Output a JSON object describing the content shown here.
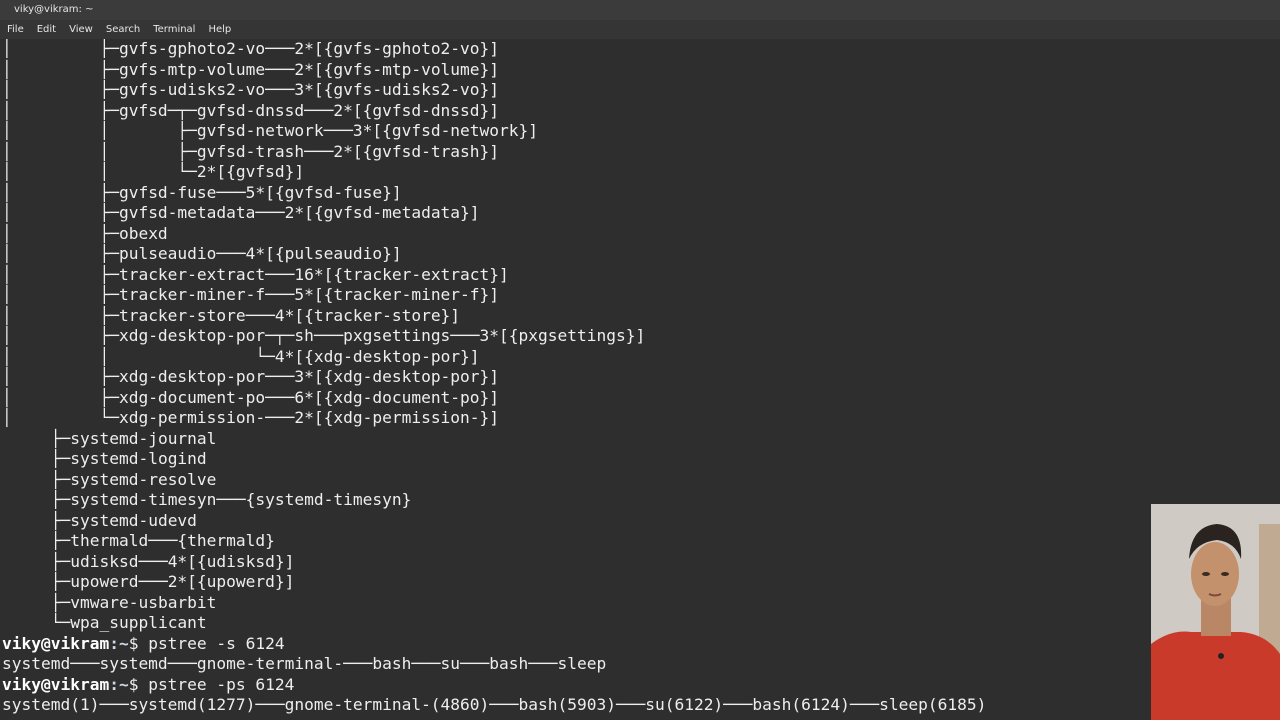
{
  "window": {
    "title": "viky@vikram: ~"
  },
  "menu": [
    "File",
    "Edit",
    "View",
    "Search",
    "Terminal",
    "Help"
  ],
  "terminal": {
    "lines": [
      {
        "tree": "│         ├─",
        "text": "gvfs-gphoto2-vo───2*[{gvfs-gphoto2-vo}]"
      },
      {
        "tree": "│         ├─",
        "text": "gvfs-mtp-volume───2*[{gvfs-mtp-volume}]"
      },
      {
        "tree": "│         ├─",
        "text": "gvfs-udisks2-vo───3*[{gvfs-udisks2-vo}]"
      },
      {
        "tree": "│         ├─",
        "text": "gvfsd─┬─gvfsd-dnssd───2*[{gvfsd-dnssd}]"
      },
      {
        "tree": "│         │       ├─",
        "text": "gvfsd-network───3*[{gvfsd-network}]"
      },
      {
        "tree": "│         │       ├─",
        "text": "gvfsd-trash───2*[{gvfsd-trash}]"
      },
      {
        "tree": "│         │       └─",
        "text": "2*[{gvfsd}]"
      },
      {
        "tree": "│         ├─",
        "text": "gvfsd-fuse───5*[{gvfsd-fuse}]"
      },
      {
        "tree": "│         ├─",
        "text": "gvfsd-metadata───2*[{gvfsd-metadata}]"
      },
      {
        "tree": "│         ├─",
        "text": "obexd"
      },
      {
        "tree": "│         ├─",
        "text": "pulseaudio───4*[{pulseaudio}]"
      },
      {
        "tree": "│         ├─",
        "text": "tracker-extract───16*[{tracker-extract}]"
      },
      {
        "tree": "│         ├─",
        "text": "tracker-miner-f───5*[{tracker-miner-f}]"
      },
      {
        "tree": "│         ├─",
        "text": "tracker-store───4*[{tracker-store}]"
      },
      {
        "tree": "│         ├─",
        "text": "xdg-desktop-por─┬─sh───pxgsettings───3*[{pxgsettings}]"
      },
      {
        "tree": "│         │               └─",
        "text": "4*[{xdg-desktop-por}]"
      },
      {
        "tree": "│         ├─",
        "text": "xdg-desktop-por───3*[{xdg-desktop-por}]"
      },
      {
        "tree": "│         ├─",
        "text": "xdg-document-po───6*[{xdg-document-po}]"
      },
      {
        "tree": "│         └─",
        "text": "xdg-permission-───2*[{xdg-permission-}]"
      },
      {
        "tree": "     ├─",
        "text": "systemd-journal"
      },
      {
        "tree": "     ├─",
        "text": "systemd-logind"
      },
      {
        "tree": "     ├─",
        "text": "systemd-resolve"
      },
      {
        "tree": "     ├─",
        "text": "systemd-timesyn───{systemd-timesyn}"
      },
      {
        "tree": "     ├─",
        "text": "systemd-udevd"
      },
      {
        "tree": "     ├─",
        "text": "thermald───{thermald}"
      },
      {
        "tree": "     ├─",
        "text": "udisksd───4*[{udisksd}]"
      },
      {
        "tree": "     ├─",
        "text": "upowerd───2*[{upowerd}]"
      },
      {
        "tree": "     ├─",
        "text": "vmware-usbarbit"
      },
      {
        "tree": "     └─",
        "text": "wpa_supplicant"
      },
      {
        "prompt": "viky@vikram",
        "path": ":~",
        "cmd": "$ pstree -s 6124"
      },
      {
        "tree": "",
        "text": "systemd───systemd───gnome-terminal-───bash───su───bash───sleep"
      },
      {
        "prompt": "viky@vikram",
        "path": ":~",
        "cmd": "$ pstree -ps 6124"
      },
      {
        "tree": "",
        "text": "systemd(1)───systemd(1277)───gnome-terminal-(4860)───bash(5903)───su(6122)───bash(6124)───sleep(6185)"
      }
    ]
  },
  "colors": {
    "background": "#2e2e2e",
    "foreground": "#eeeeee",
    "titlebar": "#3b3b3b",
    "menubar": "#353535"
  },
  "overlay": {
    "type": "webcam-video",
    "icon": "person-webcam-icon"
  }
}
